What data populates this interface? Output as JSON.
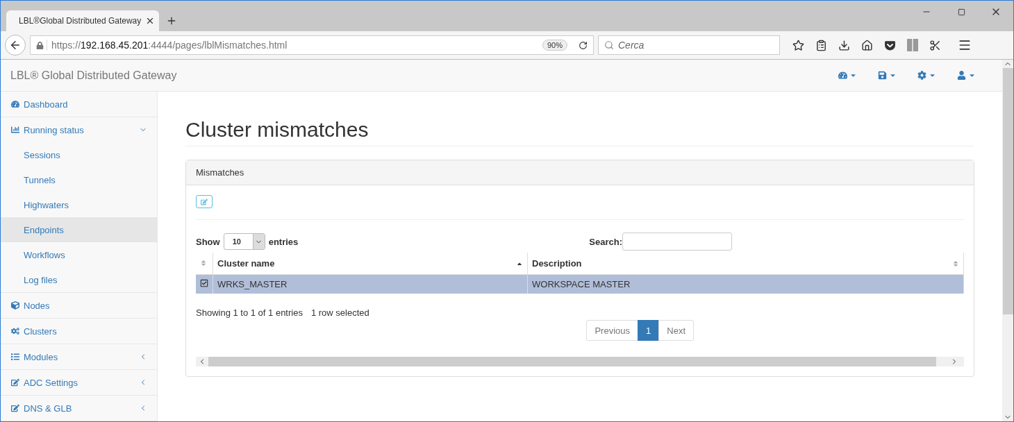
{
  "browser": {
    "tab": {
      "title": "LBL®Global Distributed Gateway"
    },
    "url": {
      "scheme": "https://",
      "host": "192.168.45.201",
      "rest": ":4444/pages/lblMismatches.html"
    },
    "zoom": "90%",
    "search": {
      "placeholder": "Cerca"
    }
  },
  "app": {
    "brand": "LBL® Global Distributed Gateway",
    "sidebar": {
      "items": [
        {
          "label": "Dashboard",
          "selected": false
        },
        {
          "label": "Running status",
          "selected": false,
          "expanded": true,
          "children": [
            {
              "label": "Sessions",
              "selected": false
            },
            {
              "label": "Tunnels",
              "selected": false
            },
            {
              "label": "Highwaters",
              "selected": false
            },
            {
              "label": "Endpoints",
              "selected": true
            },
            {
              "label": "Workflows",
              "selected": false
            },
            {
              "label": "Log files",
              "selected": false
            }
          ]
        },
        {
          "label": "Nodes",
          "selected": false
        },
        {
          "label": "Clusters",
          "selected": false
        },
        {
          "label": "Modules",
          "selected": false,
          "expanded": false
        },
        {
          "label": "ADC Settings",
          "selected": false,
          "expanded": false
        },
        {
          "label": "DNS & GLB",
          "selected": false,
          "expanded": false
        }
      ]
    },
    "page": {
      "title": "Cluster mismatches",
      "panel": {
        "heading": "Mismatches",
        "length": {
          "before": "Show",
          "value": "10",
          "after": "entries"
        },
        "search": {
          "label": "Search:"
        },
        "table": {
          "columns": [
            {
              "label": "Cluster name",
              "sorted": true
            },
            {
              "label": "Description",
              "sorted": false
            }
          ],
          "rows": [
            {
              "checked": true,
              "selected": true,
              "cells": [
                "WRKS_MASTER",
                "WORKSPACE MASTER"
              ]
            }
          ]
        },
        "info": "Showing 1 to 1 of 1 entries",
        "select_info": "1 row selected",
        "pagination": [
          {
            "label": "Previous",
            "selected": false
          },
          {
            "label": "1",
            "selected": true
          },
          {
            "label": "Next",
            "selected": false
          }
        ]
      }
    }
  }
}
